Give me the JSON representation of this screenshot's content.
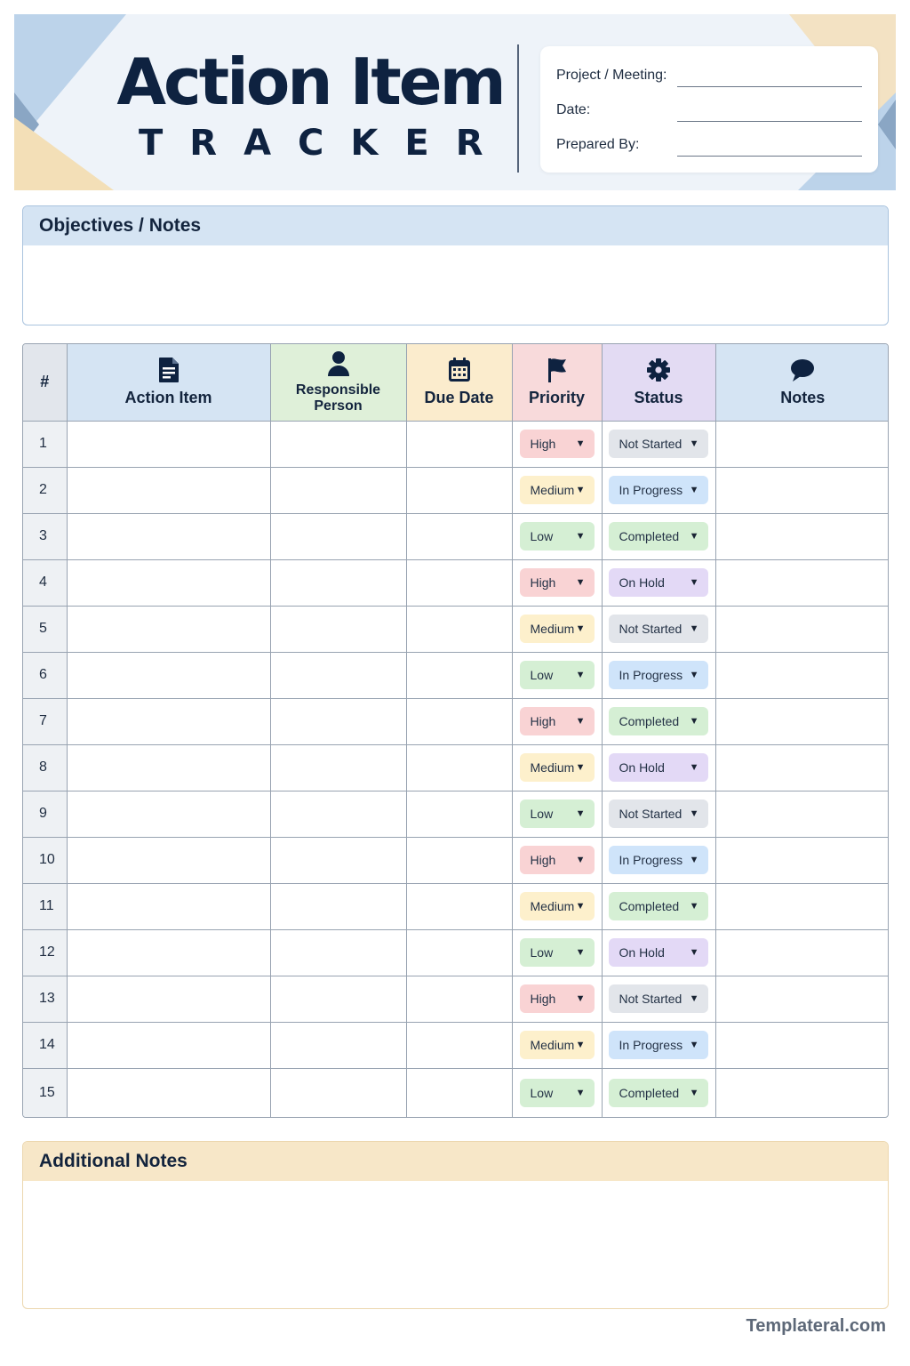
{
  "header": {
    "title": "Action Item",
    "subtitle": "TRACKER",
    "meta": [
      {
        "label": "Project / Meeting:"
      },
      {
        "label": "Date:"
      },
      {
        "label": "Prepared By:"
      }
    ]
  },
  "objectives": {
    "title": "Objectives / Notes"
  },
  "table": {
    "columns": {
      "num": "#",
      "item": {
        "label": "Action Item",
        "icon": "document-icon"
      },
      "person": {
        "label": "Responsible Person",
        "icon": "person-icon"
      },
      "due": {
        "label": "Due Date",
        "icon": "calendar-icon"
      },
      "priority": {
        "label": "Priority",
        "icon": "flag-icon"
      },
      "status": {
        "label": "Status",
        "icon": "gear-icon"
      },
      "notes": {
        "label": "Notes",
        "icon": "speech-bubble-icon"
      }
    },
    "rows": [
      {
        "num": "1",
        "priority": "High",
        "status": "Not Started"
      },
      {
        "num": "2",
        "priority": "Medium",
        "status": "In Progress"
      },
      {
        "num": "3",
        "priority": "Low",
        "status": "Completed"
      },
      {
        "num": "4",
        "priority": "High",
        "status": "On Hold"
      },
      {
        "num": "5",
        "priority": "Medium",
        "status": "Not Started"
      },
      {
        "num": "6",
        "priority": "Low",
        "status": "In Progress"
      },
      {
        "num": "7",
        "priority": "High",
        "status": "Completed"
      },
      {
        "num": "8",
        "priority": "Medium",
        "status": "On Hold"
      },
      {
        "num": "9",
        "priority": "Low",
        "status": "Not Started"
      },
      {
        "num": "10",
        "priority": "High",
        "status": "In Progress"
      },
      {
        "num": "11",
        "priority": "Medium",
        "status": "Completed"
      },
      {
        "num": "12",
        "priority": "Low",
        "status": "On Hold"
      },
      {
        "num": "13",
        "priority": "High",
        "status": "Not Started"
      },
      {
        "num": "14",
        "priority": "Medium",
        "status": "In Progress"
      },
      {
        "num": "15",
        "priority": "Low",
        "status": "Completed"
      }
    ]
  },
  "additional": {
    "title": "Additional Notes"
  },
  "footer": {
    "brand": "Templateral.com"
  },
  "colors": {
    "navy": "#0e2240",
    "priority_high": "#f9d3d4",
    "priority_medium": "#fdf0cc",
    "priority_low": "#d5efd4",
    "status_not_started": "#e2e5ea",
    "status_in_progress": "#cfe4fa",
    "status_completed": "#d5efd4",
    "status_on_hold": "#e3d9f6"
  }
}
